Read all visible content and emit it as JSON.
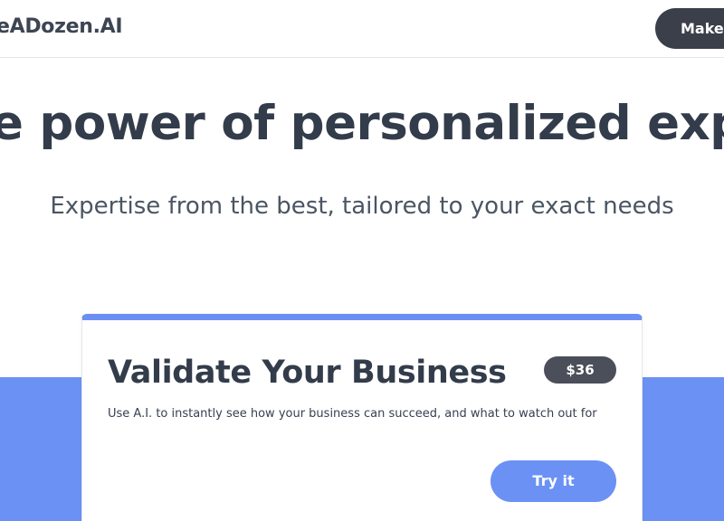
{
  "header": {
    "logo_text": "eADozen.AI",
    "cta_label": "Make y"
  },
  "hero": {
    "title": "e power of personalized expert",
    "subtitle": "Expertise from the best, tailored to your exact needs"
  },
  "card": {
    "title": "Validate Your Business",
    "price": "$36",
    "description": "Use A.I. to instantly see how your business can succeed, and what to watch out for",
    "button_label": "Try it"
  },
  "colors": {
    "accent_blue": "#6b91f5",
    "dark_text": "#333c4b",
    "dark_button": "#3b3f4a"
  }
}
